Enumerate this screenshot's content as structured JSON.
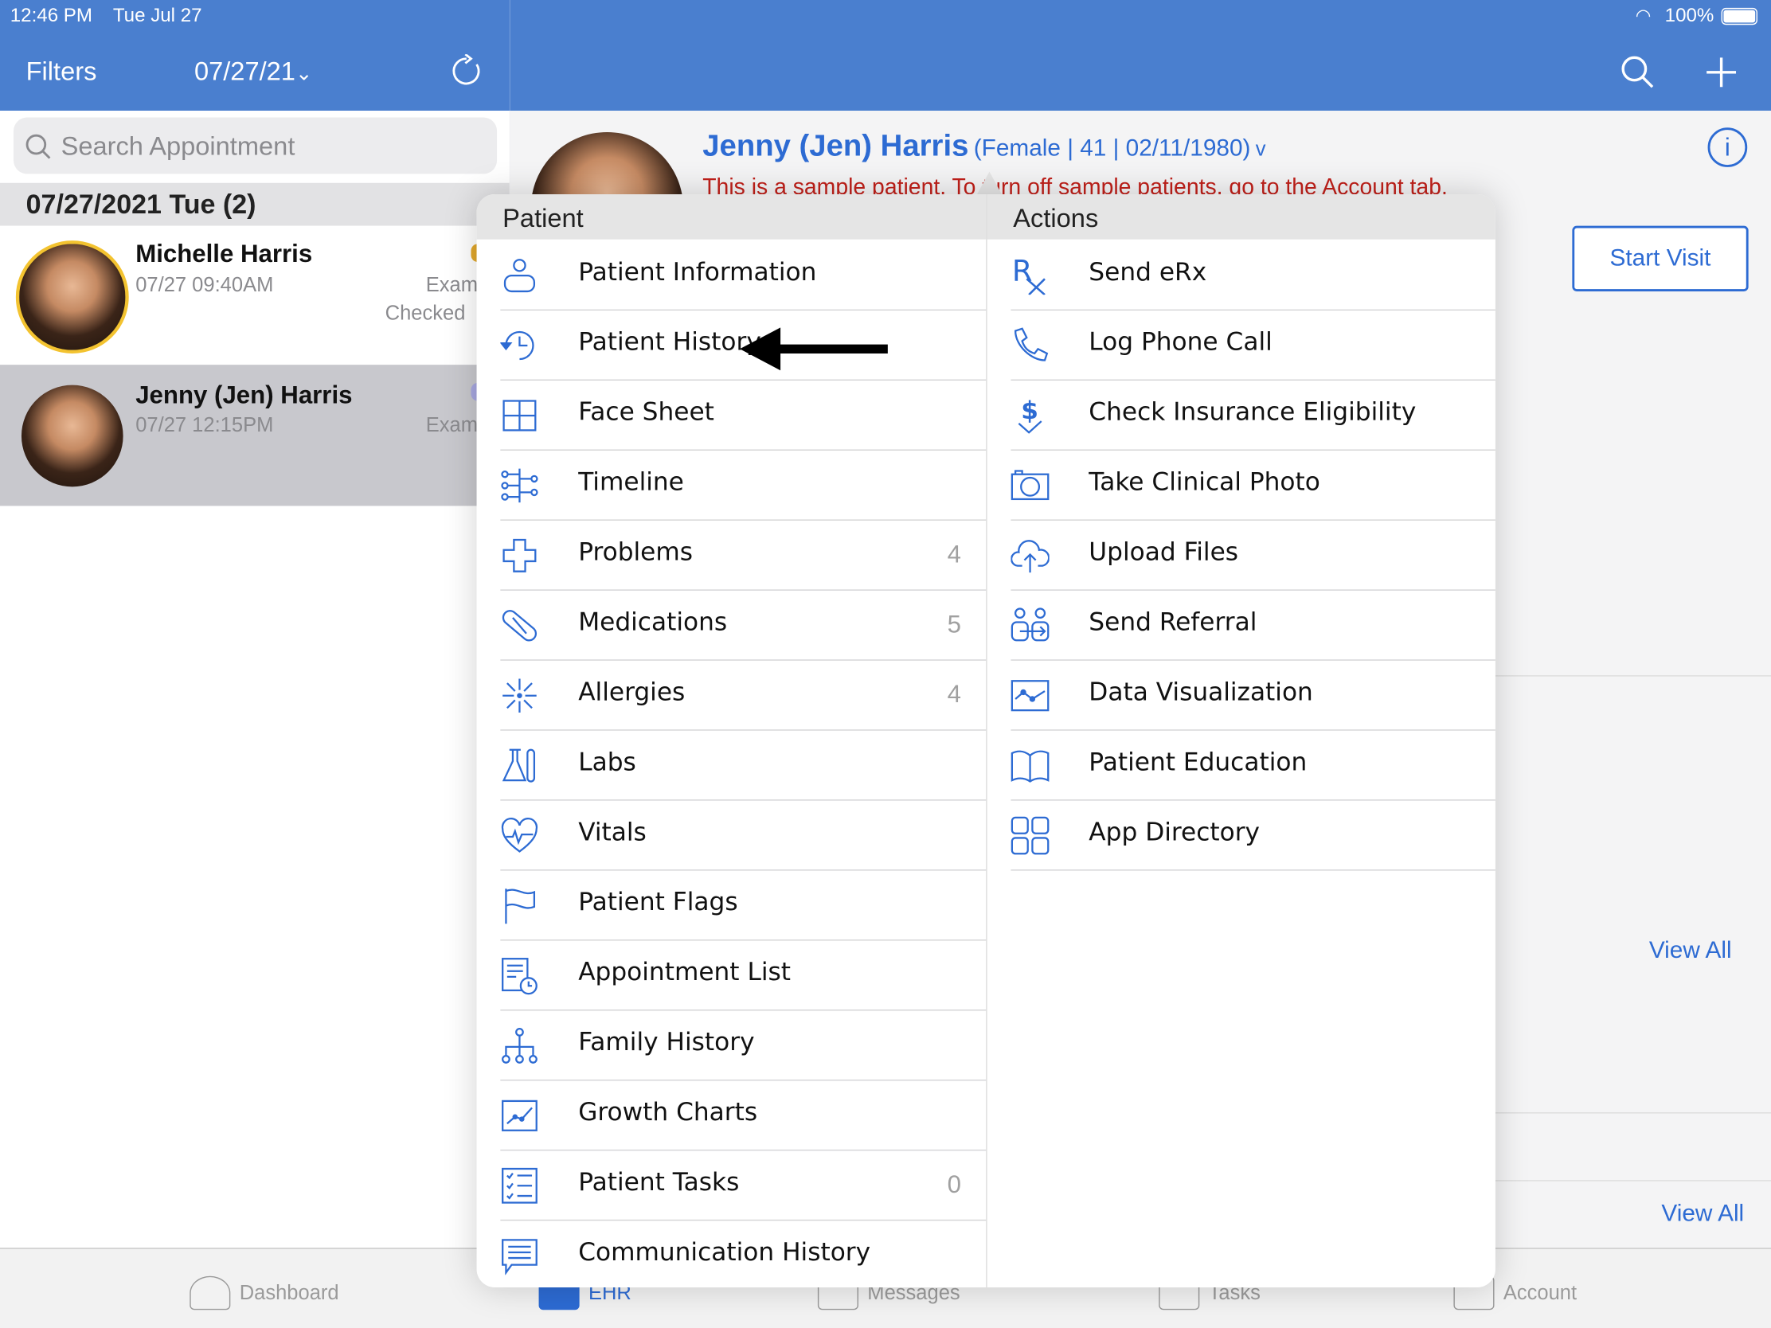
{
  "status_bar": {
    "time": "12:46 PM",
    "date": "Tue Jul 27",
    "battery": "100%"
  },
  "header": {
    "filters_label": "Filters",
    "date_filter": "07/27/21",
    "date_chevron": "⌄"
  },
  "search": {
    "placeholder": "Search Appointment"
  },
  "appointments": {
    "section_title": "07/27/2021 Tue (2)",
    "items": [
      {
        "name": "Michelle Harris",
        "time": "07/27 09:40AM",
        "type": "Exam",
        "status": "Checked"
      },
      {
        "name": "Jenny (Jen) Harris",
        "time": "07/27 12:15PM",
        "type": "Exam",
        "status": ""
      }
    ]
  },
  "patient": {
    "name": "Jenny (Jen) Harris",
    "details": "(Female | 41 | 02/11/1980)",
    "chevron": "v",
    "sample_notice": "This is a sample patient. To turn off sample patients, go to the Account tab.",
    "start_visit": "Start Visit",
    "view_all_1": "View All",
    "view_all_2": "View All"
  },
  "menu": {
    "patient_header": "Patient",
    "actions_header": "Actions",
    "patient_items": [
      {
        "label": "Patient Information",
        "icon": "person-icon",
        "count": ""
      },
      {
        "label": "Patient History",
        "icon": "history-icon",
        "count": ""
      },
      {
        "label": "Face Sheet",
        "icon": "grid-icon",
        "count": ""
      },
      {
        "label": "Timeline",
        "icon": "timeline-icon",
        "count": ""
      },
      {
        "label": "Problems",
        "icon": "cross-icon",
        "count": "4"
      },
      {
        "label": "Medications",
        "icon": "pill-icon",
        "count": "5"
      },
      {
        "label": "Allergies",
        "icon": "allergy-burst-icon",
        "count": "4"
      },
      {
        "label": "Labs",
        "icon": "flask-icon",
        "count": ""
      },
      {
        "label": "Vitals",
        "icon": "heart-pulse-icon",
        "count": ""
      },
      {
        "label": "Patient Flags",
        "icon": "flag-icon",
        "count": ""
      },
      {
        "label": "Appointment List",
        "icon": "appointment-list-icon",
        "count": ""
      },
      {
        "label": "Family History",
        "icon": "family-tree-icon",
        "count": ""
      },
      {
        "label": "Growth Charts",
        "icon": "growth-chart-icon",
        "count": ""
      },
      {
        "label": "Patient Tasks",
        "icon": "checklist-icon",
        "count": "0"
      },
      {
        "label": "Communication History",
        "icon": "chat-list-icon",
        "count": ""
      }
    ],
    "action_items": [
      {
        "label": "Send eRx",
        "icon": "rx-icon"
      },
      {
        "label": "Log Phone Call",
        "icon": "phone-icon"
      },
      {
        "label": "Check Insurance Eligibility",
        "icon": "dollar-check-icon"
      },
      {
        "label": "Take Clinical Photo",
        "icon": "camera-icon"
      },
      {
        "label": "Upload Files",
        "icon": "cloud-upload-icon"
      },
      {
        "label": "Send Referral",
        "icon": "referral-icon"
      },
      {
        "label": "Data Visualization",
        "icon": "data-chart-icon"
      },
      {
        "label": "Patient Education",
        "icon": "book-icon"
      },
      {
        "label": "App Directory",
        "icon": "apps-grid-icon"
      }
    ]
  },
  "tabbar": {
    "items": [
      {
        "label": "Dashboard",
        "icon": "gauge-icon"
      },
      {
        "label": "EHR",
        "icon": "ehr-icon"
      },
      {
        "label": "Messages",
        "icon": "envelope-icon"
      },
      {
        "label": "Tasks",
        "icon": "tasks-icon"
      },
      {
        "label": "Account",
        "icon": "account-icon"
      }
    ]
  },
  "colors": {
    "header_blue": "#4a7fcf",
    "accent_blue": "#2d6bd3",
    "notice_red": "#c0201a",
    "ring_yellow": "#f3c330"
  }
}
